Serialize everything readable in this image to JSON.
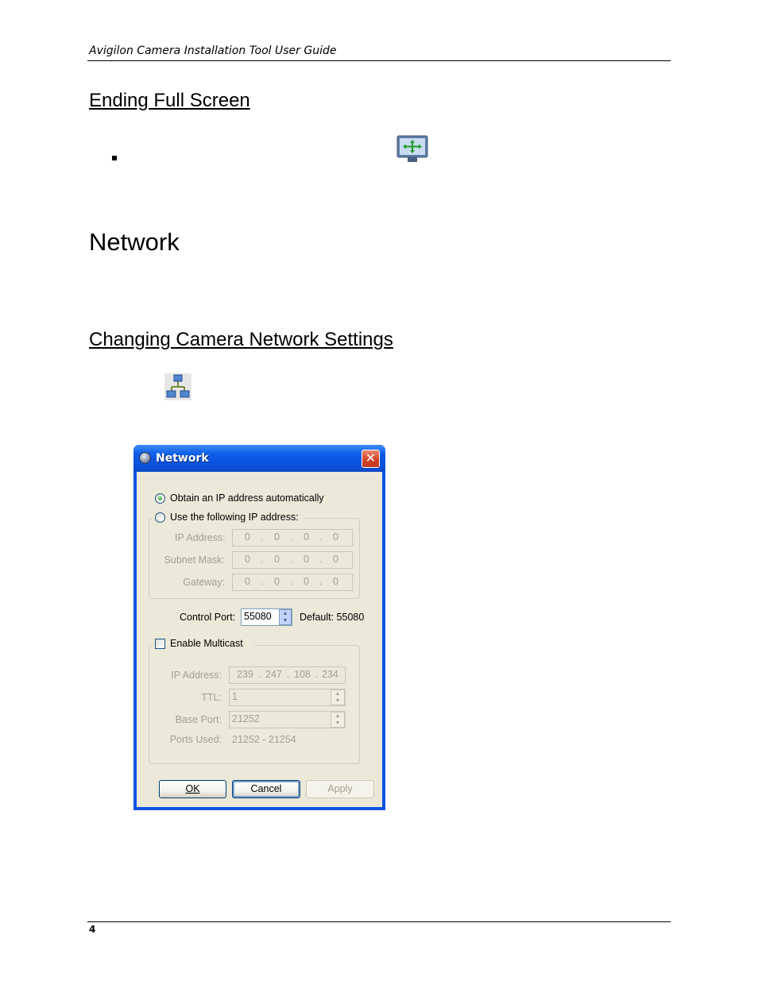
{
  "header": {
    "running_title": "Avigilon Camera Installation Tool User Guide"
  },
  "sections": {
    "ending_full_screen": "Ending Full Screen",
    "network": "Network",
    "changing_settings": "Changing Camera Network Settings"
  },
  "icons": {
    "fullscreen": "fullscreen-toggle-icon",
    "network": "network-settings-icon"
  },
  "dialog": {
    "title": "Network",
    "close": "✕",
    "obtain_auto": "Obtain an IP address automatically",
    "use_following": "Use the following IP address:",
    "ip_label": "IP Address:",
    "subnet_label": "Subnet Mask:",
    "gateway_label": "Gateway:",
    "ip_value": [
      "0",
      "0",
      "0",
      "0"
    ],
    "subnet_value": [
      "0",
      "0",
      "0",
      "0"
    ],
    "gateway_value": [
      "0",
      "0",
      "0",
      "0"
    ],
    "control_port_label": "Control Port:",
    "control_port_value": "55080",
    "control_port_default": "Default: 55080",
    "enable_multicast": "Enable Multicast",
    "mc_ip_label": "IP Address:",
    "mc_ip_value": [
      "239",
      "247",
      "108",
      "234"
    ],
    "ttl_label": "TTL:",
    "ttl_value": "1",
    "base_port_label": "Base Port:",
    "base_port_value": "21252",
    "ports_used_label": "Ports Used:",
    "ports_used_value": "21252 - 21254",
    "ok": "OK",
    "cancel": "Cancel",
    "apply": "Apply",
    "obtain_auto_selected": true,
    "multicast_enabled": false
  },
  "footer": {
    "page_number": "4"
  }
}
